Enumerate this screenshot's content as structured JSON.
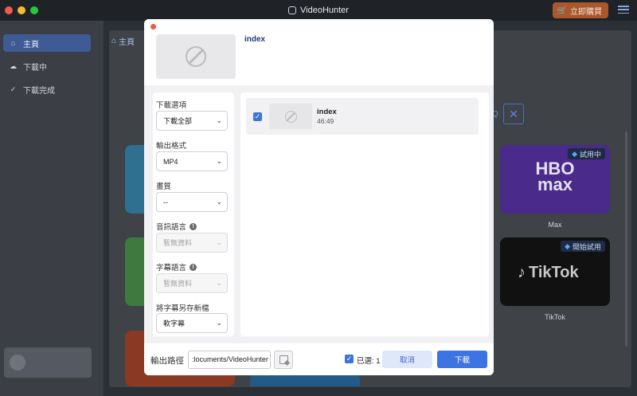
{
  "window": {
    "title": "VideoHunter",
    "buy_label": "立即購買"
  },
  "sidebar": {
    "items": [
      {
        "label": "主頁",
        "icon": "home-icon"
      },
      {
        "label": "下載中",
        "icon": "cloud-download-icon"
      },
      {
        "label": "下載完成",
        "icon": "check-circle-icon"
      }
    ]
  },
  "main": {
    "home_tab": "主頁",
    "services": [
      {
        "name": "Max",
        "logo_text": "HBO max",
        "badge": "試用中"
      },
      {
        "name": "TikTok",
        "logo_text": "TikTok",
        "badge": "開始試用"
      }
    ]
  },
  "modal": {
    "title": "index",
    "options": {
      "download_option_label": "下載選項",
      "download_option_value": "下載全部",
      "format_label": "輸出格式",
      "format_value": "MP4",
      "quality_label": "畫質",
      "quality_value": "--",
      "audio_label": "音訊語言",
      "audio_value": "暫無資料",
      "subtitle_label": "字幕語言",
      "subtitle_value": "暫無資料",
      "save_sub_label": "將字幕另存新檔",
      "save_sub_value": "軟字幕"
    },
    "videos": [
      {
        "title": "index",
        "duration": "46:49",
        "checked": true
      }
    ],
    "footer": {
      "output_label": "輸出路徑",
      "output_path": ":locuments/VideoHunter",
      "selected_label": "已選: 1",
      "cancel_label": "取消",
      "download_label": "下載"
    }
  },
  "colors": {
    "accent": "#3d74e4",
    "buy": "#a9582b",
    "sidebar_active": "#3f5b95"
  }
}
